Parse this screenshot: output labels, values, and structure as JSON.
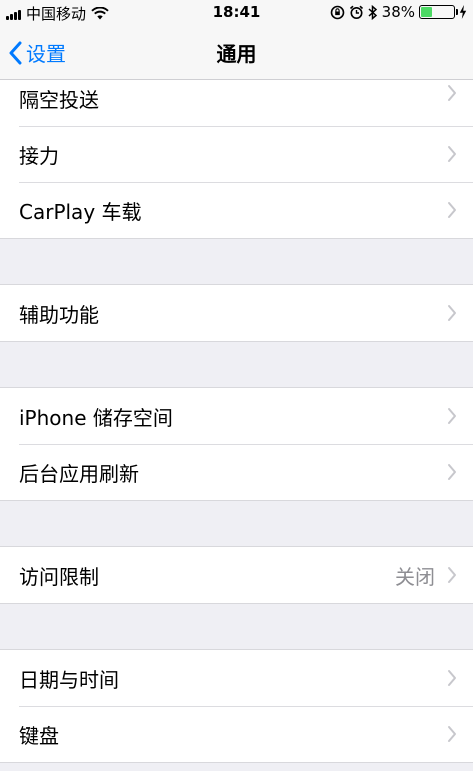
{
  "status_bar": {
    "carrier": "中国移动",
    "time": "18:41",
    "battery_percent": "38%",
    "battery_level": 0.38,
    "battery_color": "#4cd964"
  },
  "nav": {
    "back_label": "设置",
    "title": "通用",
    "accent_color": "#007aff"
  },
  "groups": [
    [
      {
        "label": "隔空投送"
      },
      {
        "label": "接力"
      },
      {
        "label": "CarPlay 车载"
      }
    ],
    [
      {
        "label": "辅助功能"
      }
    ],
    [
      {
        "label": "iPhone 储存空间"
      },
      {
        "label": "后台应用刷新"
      }
    ],
    [
      {
        "label": "访问限制",
        "value": "关闭"
      }
    ],
    [
      {
        "label": "日期与时间"
      },
      {
        "label": "键盘"
      }
    ]
  ]
}
